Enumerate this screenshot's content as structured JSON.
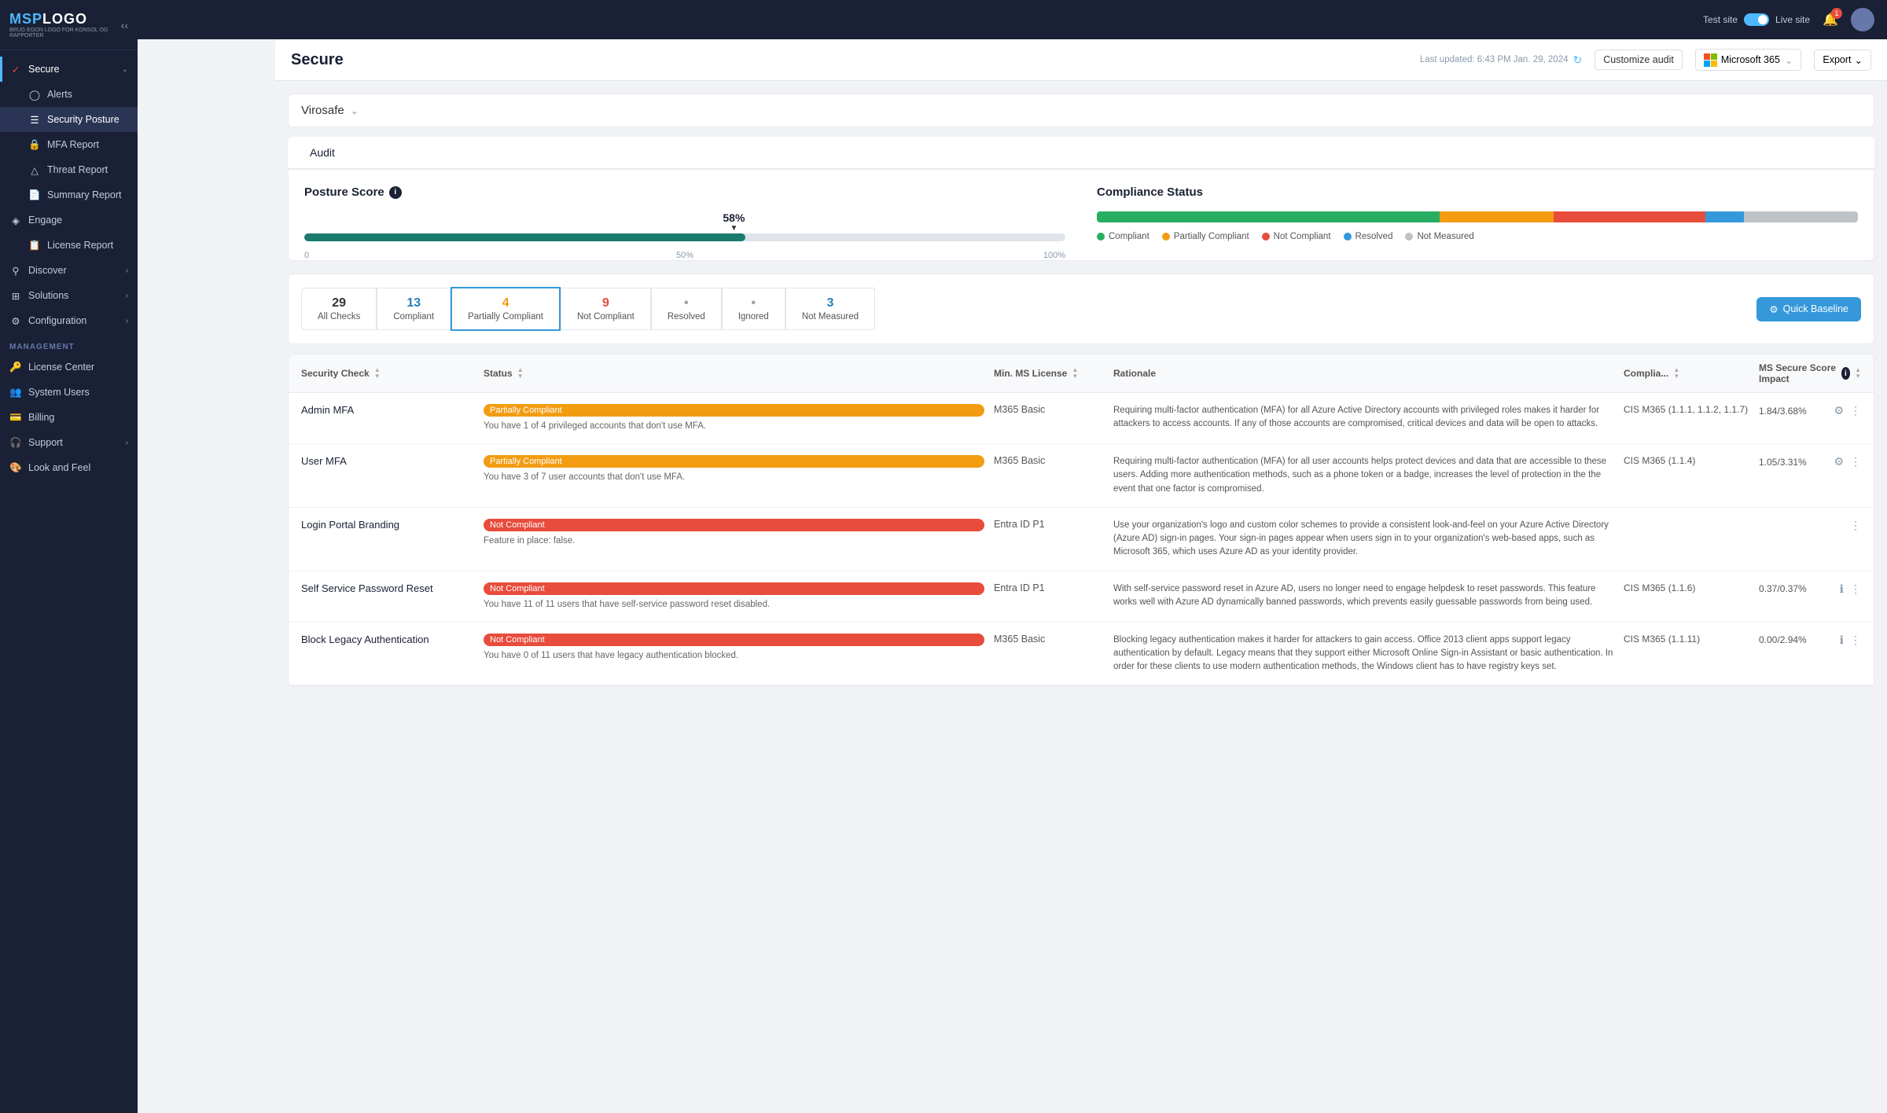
{
  "sidebar": {
    "logo": {
      "msp": "MSP",
      "logo_suffix": "LOGO",
      "sub": "BRUG EGON LOGO FOR KONSOL OG RAPPORTER"
    },
    "items": [
      {
        "id": "secure",
        "label": "Secure",
        "icon": "shield",
        "active": true,
        "hasChevron": true
      },
      {
        "id": "alerts",
        "label": "Alerts",
        "icon": "bell",
        "sub": true
      },
      {
        "id": "security-posture",
        "label": "Security Posture",
        "icon": "list",
        "sub": true,
        "active": true
      },
      {
        "id": "mfa-report",
        "label": "MFA Report",
        "icon": "lock",
        "sub": true
      },
      {
        "id": "threat-report",
        "label": "Threat Report",
        "icon": "triangle",
        "sub": true
      },
      {
        "id": "summary-report",
        "label": "Summary Report",
        "icon": "file",
        "sub": true
      },
      {
        "id": "engage",
        "label": "Engage",
        "icon": "nodes",
        "hasChevron": false
      },
      {
        "id": "license-report",
        "label": "License Report",
        "icon": "doc",
        "sub": true
      },
      {
        "id": "discover",
        "label": "Discover",
        "icon": "search",
        "hasChevron": true
      },
      {
        "id": "solutions",
        "label": "Solutions",
        "icon": "grid",
        "hasChevron": true
      },
      {
        "id": "configuration",
        "label": "Configuration",
        "icon": "gear",
        "hasChevron": true
      }
    ],
    "management": {
      "label": "MANAGEMENT",
      "items": [
        {
          "id": "license-center",
          "label": "License Center",
          "icon": "key"
        },
        {
          "id": "system-users",
          "label": "System Users",
          "icon": "users"
        },
        {
          "id": "billing",
          "label": "Billing",
          "icon": "credit"
        },
        {
          "id": "support",
          "label": "Support",
          "icon": "headset",
          "hasChevron": true
        },
        {
          "id": "look-feel",
          "label": "Look and Feel",
          "icon": "paint"
        }
      ]
    }
  },
  "topbar": {
    "test_site_label": "Test site",
    "live_site_label": "Live site",
    "notification_count": "1"
  },
  "page": {
    "title": "Secure",
    "last_updated": "Last updated: 6:43 PM Jan. 29, 2024",
    "customize_label": "Customize audit",
    "ms365_label": "Microsoft 365",
    "export_label": "Export"
  },
  "company": {
    "name": "Virosafe"
  },
  "tabs": [
    {
      "label": "Audit",
      "active": true
    }
  ],
  "posture_score": {
    "title": "Posture Score",
    "value": "58%",
    "percent": 58,
    "ticks": [
      "0",
      "50%",
      "100%"
    ]
  },
  "compliance_status": {
    "title": "Compliance Status",
    "segments": [
      {
        "label": "Compliant",
        "color": "#27ae60",
        "width": 45
      },
      {
        "label": "Partially Compliant",
        "color": "#f39c12",
        "width": 15
      },
      {
        "label": "Not Compliant",
        "color": "#e74c3c",
        "width": 20
      },
      {
        "label": "Resolved",
        "color": "#3498db",
        "width": 5
      },
      {
        "label": "Not Measured",
        "color": "#bdc3c7",
        "width": 15
      }
    ]
  },
  "filter_tabs": [
    {
      "count": "29",
      "label": "All Checks",
      "color": "default",
      "active": false
    },
    {
      "count": "13",
      "label": "Compliant",
      "color": "blue",
      "active": false
    },
    {
      "count": "4",
      "label": "Partially Compliant",
      "color": "orange",
      "active": false
    },
    {
      "count": "9",
      "label": "Not Compliant",
      "color": "red",
      "active": true
    },
    {
      "count": "",
      "label": "Resolved",
      "color": "gray",
      "active": false
    },
    {
      "count": "",
      "label": "Ignored",
      "color": "gray",
      "active": false
    },
    {
      "count": "3",
      "label": "Not Measured",
      "color": "blue",
      "active": false
    }
  ],
  "quick_baseline_label": "Quick Baseline",
  "table": {
    "columns": [
      {
        "label": "Security Check"
      },
      {
        "label": "Status"
      },
      {
        "label": "Min. MS License"
      },
      {
        "label": "Rationale"
      },
      {
        "label": "Complia..."
      },
      {
        "label": "MS Secure Score Impact"
      }
    ],
    "rows": [
      {
        "name": "Admin MFA",
        "status_badge": "Partially Compliant",
        "status_type": "partial",
        "status_desc": "You have 1 of 4 privileged accounts that don't use MFA.",
        "license": "M365 Basic",
        "rationale": "Requiring multi-factor authentication (MFA) for all Azure Active Directory accounts with privileged roles makes it harder for attackers to access accounts. If any of those accounts are compromised, critical devices and data will be open to attacks.",
        "compliance": "CIS M365 (1.1.1, 1.1.2, 1.1.7)",
        "score": "1.84/3.68%"
      },
      {
        "name": "User MFA",
        "status_badge": "Partially Compliant",
        "status_type": "partial",
        "status_desc": "You have 3 of 7 user accounts that don't use MFA.",
        "license": "M365 Basic",
        "rationale": "Requiring multi-factor authentication (MFA) for all user accounts helps protect devices and data that are accessible to these users. Adding more authentication methods, such as a phone token or a badge, increases the level of protection in the the event that one factor is compromised.",
        "compliance": "CIS M365 (1.1.4)",
        "score": "1.05/3.31%"
      },
      {
        "name": "Login Portal Branding",
        "status_badge": "Not Compliant",
        "status_type": "not",
        "status_desc": "Feature in place: false.",
        "license": "Entra ID P1",
        "rationale": "Use your organization's logo and custom color schemes to provide a consistent look-and-feel on your Azure Active Directory (Azure AD) sign-in pages. Your sign-in pages appear when users sign in to your organization's web-based apps, such as Microsoft 365, which uses Azure AD as your identity provider.",
        "compliance": "",
        "score": ""
      },
      {
        "name": "Self Service Password Reset",
        "status_badge": "Not Compliant",
        "status_type": "not",
        "status_desc": "You have 11 of 11 users that have self-service password reset disabled.",
        "license": "Entra ID P1",
        "rationale": "With self-service password reset in Azure AD, users no longer need to engage helpdesk to reset passwords. This feature works well with Azure AD dynamically banned passwords, which prevents easily guessable passwords from being used.",
        "compliance": "CIS M365 (1.1.6)",
        "score": "0.37/0.37%"
      },
      {
        "name": "Block Legacy Authentication",
        "status_badge": "Not Compliant",
        "status_type": "not",
        "status_desc": "You have 0 of 11 users that have legacy authentication blocked.",
        "license": "M365 Basic",
        "rationale": "Blocking legacy authentication makes it harder for attackers to gain access. Office 2013 client apps support legacy authentication by default. Legacy means that they support either Microsoft Online Sign-in Assistant or basic authentication. In order for these clients to use modern authentication methods, the Windows client has to have registry keys set.",
        "compliance": "CIS M365 (1.1.11)",
        "score": "0.00/2.94%"
      }
    ]
  }
}
